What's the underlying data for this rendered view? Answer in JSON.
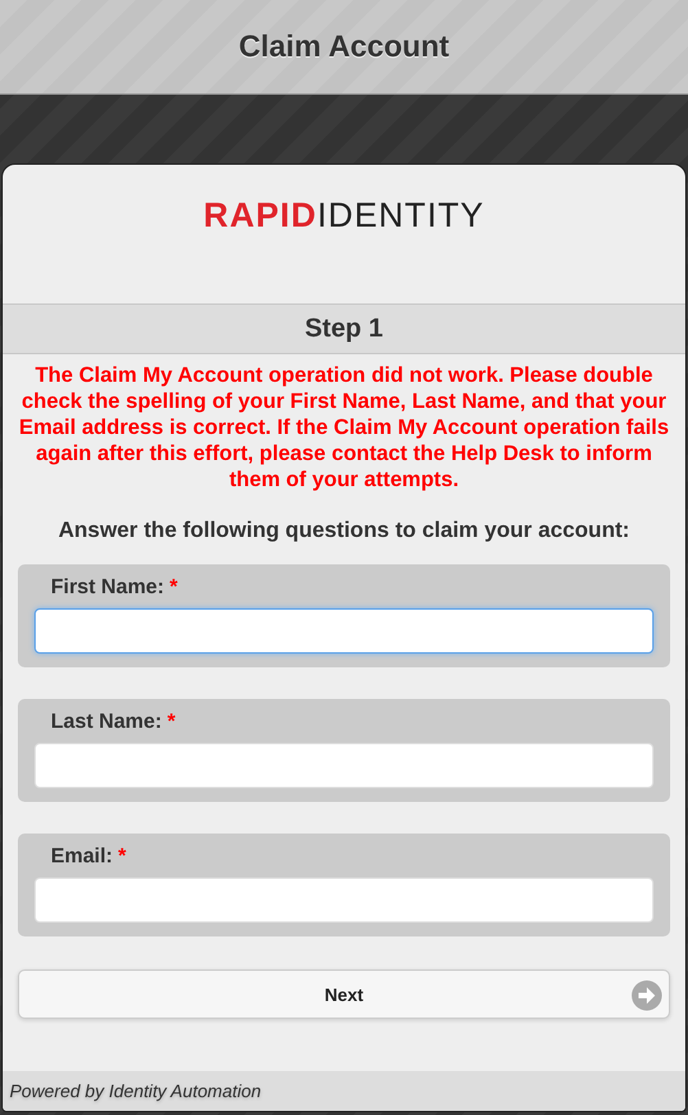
{
  "header": {
    "title": "Claim Account"
  },
  "logo": {
    "bold_part": "RAPID",
    "light_part": "IDENTITY"
  },
  "step": {
    "title": "Step 1"
  },
  "error_message": "The Claim My Account operation did not work. Please double check the spelling of your First Name, Last Name, and that your Email address is correct. If the Claim My Account operation fails again after this effort, please contact the Help Desk to inform them of your attempts.",
  "instructions": "Answer the following questions to claim your account:",
  "fields": [
    {
      "label": "First Name:",
      "required_mark": "*",
      "focused": true
    },
    {
      "label": "Last Name:",
      "required_mark": "*",
      "focused": false
    },
    {
      "label": "Email:",
      "required_mark": "*",
      "focused": false
    }
  ],
  "next_button": {
    "label": "Next"
  },
  "footer": {
    "text": "Powered by Identity Automation"
  }
}
